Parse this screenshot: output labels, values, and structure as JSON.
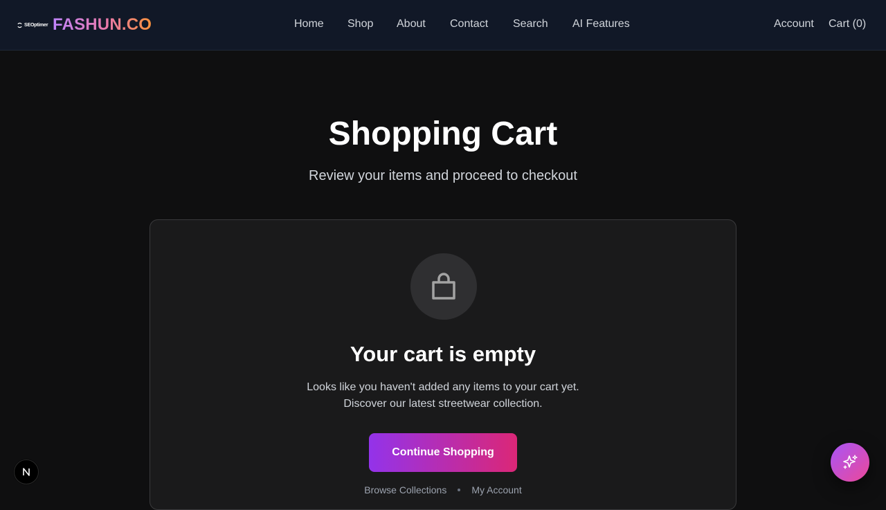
{
  "header": {
    "seo_logo_text": "SEOptimer",
    "brand": "FASHUN.CO",
    "nav": {
      "home": "Home",
      "shop": "Shop",
      "about": "About",
      "contact": "Contact",
      "search": "Search",
      "ai_features": "AI Features"
    },
    "account": "Account",
    "cart": "Cart (0)"
  },
  "page": {
    "title": "Shopping Cart",
    "subtitle": "Review your items and proceed to checkout"
  },
  "empty_cart": {
    "icon": "shopping-bag-icon",
    "title": "Your cart is empty",
    "desc_line1": "Looks like you haven't added any items to your cart yet.",
    "desc_line2": "Discover our latest streetwear collection.",
    "button": "Continue Shopping",
    "links": {
      "browse": "Browse Collections",
      "my_account": "My Account"
    }
  },
  "floating": {
    "next_badge_icon": "nextjs-n-icon",
    "ai_button_icon": "sparkles-icon"
  },
  "colors": {
    "background": "#0f0f10",
    "header": "#111827",
    "card": "#1a1a1b",
    "gradient_start": "#9333ea",
    "gradient_end": "#db2777"
  }
}
